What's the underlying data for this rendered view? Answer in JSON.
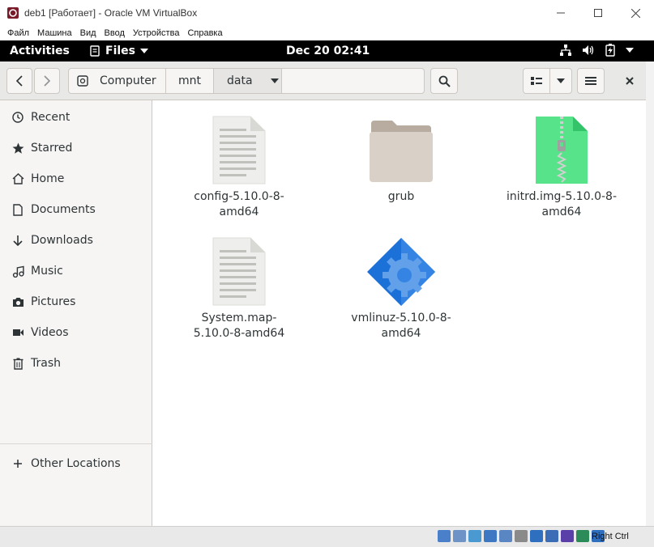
{
  "window": {
    "title": "deb1 [Работает] - Oracle VM VirtualBox"
  },
  "vbox_menu": [
    "Файл",
    "Машина",
    "Вид",
    "Ввод",
    "Устройства",
    "Справка"
  ],
  "gnome": {
    "activities": "Activities",
    "app_name": "Files",
    "clock": "Dec 20  02:41"
  },
  "path": {
    "root_label": "Computer",
    "segment1": "mnt",
    "segment2": "data"
  },
  "sidebar": {
    "items": [
      {
        "label": "Recent",
        "icon": "clock-icon"
      },
      {
        "label": "Starred",
        "icon": "star-icon"
      },
      {
        "label": "Home",
        "icon": "home-icon"
      },
      {
        "label": "Documents",
        "icon": "document-icon"
      },
      {
        "label": "Downloads",
        "icon": "download-icon"
      },
      {
        "label": "Music",
        "icon": "music-icon"
      },
      {
        "label": "Pictures",
        "icon": "camera-icon"
      },
      {
        "label": "Videos",
        "icon": "video-icon"
      },
      {
        "label": "Trash",
        "icon": "trash-icon"
      }
    ],
    "other_locations": "Other Locations"
  },
  "files": [
    {
      "name": "config-5.10.0-8-amd64",
      "type": "text"
    },
    {
      "name": "grub",
      "type": "folder"
    },
    {
      "name": "initrd.img-5.10.0-8-amd64",
      "type": "archive"
    },
    {
      "name": "System.map-5.10.0-8-amd64",
      "type": "text"
    },
    {
      "name": "vmlinuz-5.10.0-8-amd64",
      "type": "executable"
    }
  ],
  "status": {
    "host_key": "Right Ctrl"
  },
  "colors": {
    "gnome_bar": "#000000",
    "headerbar": "#e8e8e7",
    "sidebar": "#f6f5f4",
    "archive_green": "#57e389",
    "folder": "#d5cdc4",
    "executable_blue": "#3584e4"
  }
}
